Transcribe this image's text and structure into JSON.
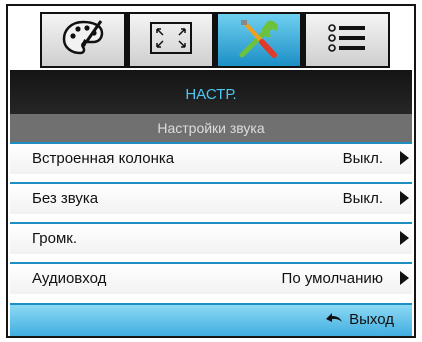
{
  "tabs": [
    {
      "icon": "palette-icon",
      "active": false
    },
    {
      "icon": "display-resize-icon",
      "active": false
    },
    {
      "icon": "tools-icon",
      "active": true
    },
    {
      "icon": "list-options-icon",
      "active": false
    }
  ],
  "header": {
    "title": "НАСТР.",
    "subtitle": "Настройки звука"
  },
  "items": [
    {
      "label": "Встроенная колонка",
      "value": "Выкл."
    },
    {
      "label": "Без звука",
      "value": "Выкл."
    },
    {
      "label": "Громк.",
      "value": ""
    },
    {
      "label": "Аудиовход",
      "value": "По умолчанию"
    }
  ],
  "footer": {
    "exit_label": "Выход"
  },
  "colors": {
    "accent": "#1f8fc2",
    "title_text": "#4ec6ef"
  }
}
